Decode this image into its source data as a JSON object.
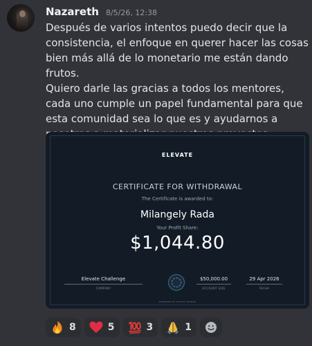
{
  "message": {
    "author": "Nazareth",
    "timestamp": "8/5/26, 12:38",
    "text": "Después de varios intentos puedo decir que la consistencia, el enfoque en querer hacer las cosas bien más allá de lo monetario me están dando frutos.\nQuiero darle las gracias a todos los mentores, cada uno cumple un papel fundamental para que esta comunidad sea lo que es y ayudarnos a nosotros a materializar nuestros proyectos. Gracias, gracias",
    "trailing_emoji": "blue-heart-icon"
  },
  "certificate": {
    "logo": "ELEVATE",
    "title": "CERTIFICATE FOR WITHDRAWAL",
    "awarded_text": "The Certificate is awarded to:",
    "recipient": "Milangely Rada",
    "profit_label": "Your Profit Share:",
    "amount": "$1,044.80",
    "company_value": "Elevate Challenge",
    "company_label": "COMPANY",
    "account_size_value": "$50,000.00",
    "account_size_label": "ACCOUNT SIZE",
    "date_value": "29 Apr 2026",
    "date_label": "FECHA",
    "footer": "POWERED BY MATCH-TRADER"
  },
  "reactions": [
    {
      "emoji": "fire-icon",
      "count": "8"
    },
    {
      "emoji": "red-heart-icon",
      "count": "5"
    },
    {
      "emoji": "hundred-points-icon",
      "count": "3"
    },
    {
      "emoji": "folded-hands-icon",
      "count": "1"
    }
  ],
  "colors": {
    "background": "#313338",
    "reaction_bg": "#2b2d31",
    "certificate_bg": "#131c26",
    "blue_heart": "#5aa7ea"
  }
}
